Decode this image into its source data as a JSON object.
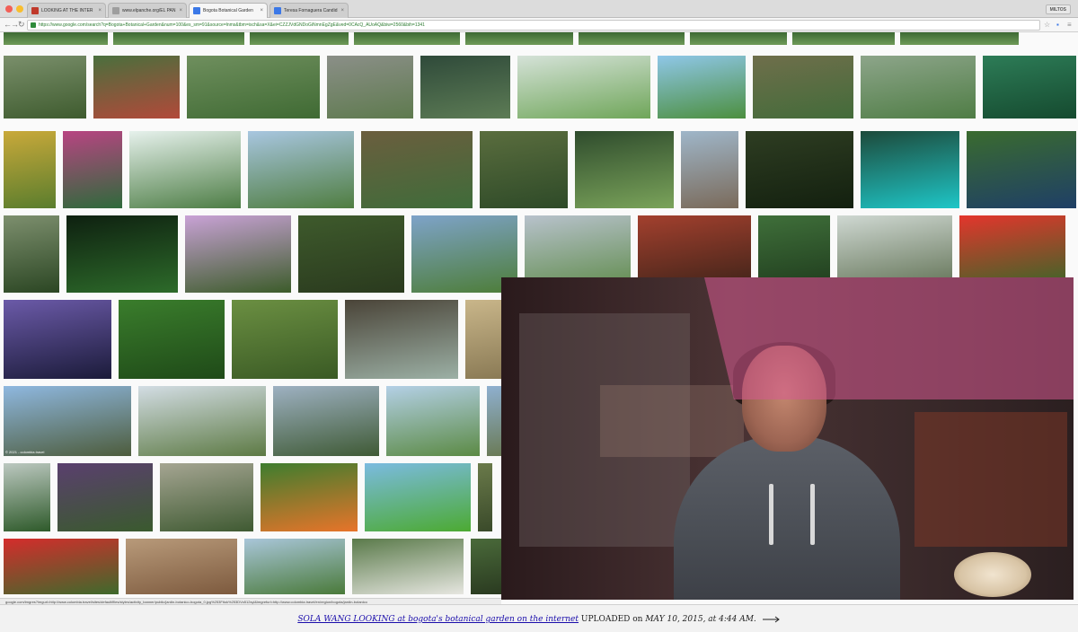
{
  "browser": {
    "traffic_lights": [
      "#f25f57",
      "#f8be2f",
      "#2ac840"
    ],
    "tabs": [
      {
        "title": "LOOKING AT THE INTER",
        "favicon_color": "#c0392b",
        "active": false
      },
      {
        "title": "www.elpanche.org/EL PAN",
        "favicon_color": "#9e9e9e",
        "active": false
      },
      {
        "title": "Bogota Botanical Garden",
        "favicon_color": "#3b78e7",
        "active": true
      },
      {
        "title": "Teresa Fornaguera Candid",
        "favicon_color": "#3b78e7",
        "active": false
      }
    ],
    "tab_close": "×",
    "user_badge": "MILTOS",
    "address": {
      "url": "https://www.google.com/search?q=Bogota+Botanical+Garden&num=100&es_sm=91&source=lnms&tbm=isch&sa=X&ei=CZZJVdGNDoGiNmnEgZgE&ved=0CAcQ_AUoAQ&biw=2560&bih=1341",
      "back": "←",
      "forward": "→",
      "reload": "↻",
      "star": "☆",
      "menu": "≡"
    }
  },
  "results": {
    "rows": [
      [
        {
          "label": "formal garden",
          "c1": "#7a8f6b",
          "c2": "#3e5b2e"
        },
        {
          "label": "garden beds",
          "c1": "#4a6f3d",
          "c2": "#b2493a"
        },
        {
          "label": "palm garden",
          "c1": "#6f8f5e",
          "c2": "#3f6a33"
        },
        {
          "label": "signboard path",
          "c1": "#8b8f88",
          "c2": "#5e7a4e"
        },
        {
          "label": "water lilies pond",
          "c1": "#2f4a3a",
          "c2": "#5d7c55"
        },
        {
          "label": "palm lawn",
          "c1": "#d5e2d8",
          "c2": "#6fa659"
        },
        {
          "label": "park sky",
          "c1": "#8fc7e8",
          "c2": "#4c8f3f"
        },
        {
          "label": "greenhouse",
          "c1": "#6f6e4b",
          "c2": "#436c3a"
        },
        {
          "label": "pond garden",
          "c1": "#8da58a",
          "c2": "#4f7d45"
        },
        {
          "label": "giant leaves",
          "c1": "#2d7c57",
          "c2": "#154a2f"
        }
      ],
      [
        {
          "label": "frog on leaf",
          "c1": "#c9a93a",
          "c2": "#5a7d2d"
        },
        {
          "label": "pink orchid",
          "c1": "#b84482",
          "c2": "#2e6a3b"
        },
        {
          "label": "waterfall",
          "c1": "#e6f1ec",
          "c2": "#4d7d45"
        },
        {
          "label": "pond bridge",
          "c1": "#a8c6e0",
          "c2": "#4f7d40"
        },
        {
          "label": "fountain wall",
          "c1": "#6b5e3e",
          "c2": "#3f6c3a"
        },
        {
          "label": "couple portrait",
          "c1": "#5a6d3e",
          "c2": "#2e4a28"
        },
        {
          "label": "park sign",
          "c1": "#2f4c2d",
          "c2": "#7aa35a"
        },
        {
          "label": "statue plaza",
          "c1": "#9fb6c9",
          "c2": "#7a6a5a"
        },
        {
          "label": "dark jungle",
          "c1": "#2e3d22",
          "c2": "#13200f"
        },
        {
          "label": "lit waterfall",
          "c1": "#1d4a3b",
          "c2": "#1ec6c7"
        },
        {
          "label": "red flowers pond",
          "c1": "#3a6b2f",
          "c2": "#1f3f66"
        }
      ],
      [
        {
          "label": "palm trunk",
          "c1": "#7d8f6e",
          "c2": "#2b4623"
        },
        {
          "label": "night greenhouse",
          "c1": "#0e2010",
          "c2": "#2d6b2a"
        },
        {
          "label": "purple orchid",
          "c1": "#c9a2d6",
          "c2": "#3c5c2a"
        },
        {
          "label": "crowd lawn",
          "c1": "#3e5a2c",
          "c2": "#2a3a1e"
        },
        {
          "label": "sunny trees",
          "c1": "#7ea3c9",
          "c2": "#4d7d38"
        },
        {
          "label": "mountain meadow",
          "c1": "#b8c2cc",
          "c2": "#5d8a48"
        },
        {
          "label": "red pavilion",
          "c1": "#a3402e",
          "c2": "#3a2218"
        },
        {
          "label": "vine canopy",
          "c1": "#3f6f3a",
          "c2": "#1e3a1c"
        },
        {
          "label": "glass dome",
          "c1": "#cfd8d2",
          "c2": "#5d6e50"
        },
        {
          "label": "red lily",
          "c1": "#e4352c",
          "c2": "#2f6a28"
        }
      ],
      [
        {
          "label": "city sunset",
          "c1": "#6b5aa8",
          "c2": "#1b1b3a"
        },
        {
          "label": "fern path",
          "c1": "#3a7d2c",
          "c2": "#1f4a18"
        },
        {
          "label": "trail fern",
          "c1": "#6b8f42",
          "c2": "#3a5a24"
        },
        {
          "label": "iron canopy",
          "c1": "#4a4438",
          "c2": "#9cb0a5"
        },
        {
          "label": "edge",
          "c1": "#c9b68a",
          "c2": "#8a7a55"
        }
      ],
      [
        {
          "label": "lake bridge",
          "c1": "#8fb8e0",
          "c2": "#4d5c3c"
        },
        {
          "label": "pond pavilion",
          "c1": "#d3dde4",
          "c2": "#5d7a44"
        },
        {
          "label": "mountain forest",
          "c1": "#9eb1c2",
          "c2": "#3f5a35"
        },
        {
          "label": "winding path",
          "c1": "#b4d0e6",
          "c2": "#5b8a44"
        },
        {
          "label": "edge",
          "c1": "#8fb0d0",
          "c2": "#6a7a55"
        }
      ],
      [
        {
          "label": "green arch",
          "c1": "#bcc8c0",
          "c2": "#2e5a2a"
        },
        {
          "label": "purple flowers",
          "c1": "#5a3f6e",
          "c2": "#3a5a2e"
        },
        {
          "label": "rock garden",
          "c1": "#a5a592",
          "c2": "#3f5a32"
        },
        {
          "label": "orange rose",
          "c1": "#3e7d2e",
          "c2": "#e8742a"
        },
        {
          "label": "lawn sky",
          "c1": "#7bbbe0",
          "c2": "#4caa32"
        },
        {
          "label": "edge",
          "c1": "#6a7a4a",
          "c2": "#3a4a2a"
        }
      ],
      [
        {
          "label": "red roses",
          "c1": "#d52c2c",
          "c2": "#3e6a2c"
        },
        {
          "label": "autumn grass",
          "c1": "#b89a7a",
          "c2": "#7d5a3e"
        },
        {
          "label": "palm avenue",
          "c1": "#a9c6d9",
          "c2": "#4a7a3a"
        },
        {
          "label": "statue fountain",
          "c1": "#5a7a4a",
          "c2": "#e6e6e0"
        },
        {
          "label": "edge",
          "c1": "#4a6a3a",
          "c2": "#2a3a20"
        }
      ]
    ],
    "caption_tag": "© 2021 - colombia.travel",
    "status_url": "google.com/imgres?imgurl=http://www.colombia.travel/sites/default/files/styles/activity_banner/public/jardin-botanico-bogota_0.jpg%253Fitok%253DVo512syl&imgrefurl=http://www.colombia.travel/en/region/bogota/jardin-botanico"
  },
  "webcam": {
    "subject": "Sola Wang",
    "pink_color": "#d75a91",
    "hoodie_color": "#4a4e55"
  },
  "footer": {
    "link_text": "SOLA WANG LOOKING at bogota's botanical garden on the internet",
    "uploaded_label": "UPLOADED on",
    "date_text": "MAY 10, 2015, at 4:44 AM."
  }
}
